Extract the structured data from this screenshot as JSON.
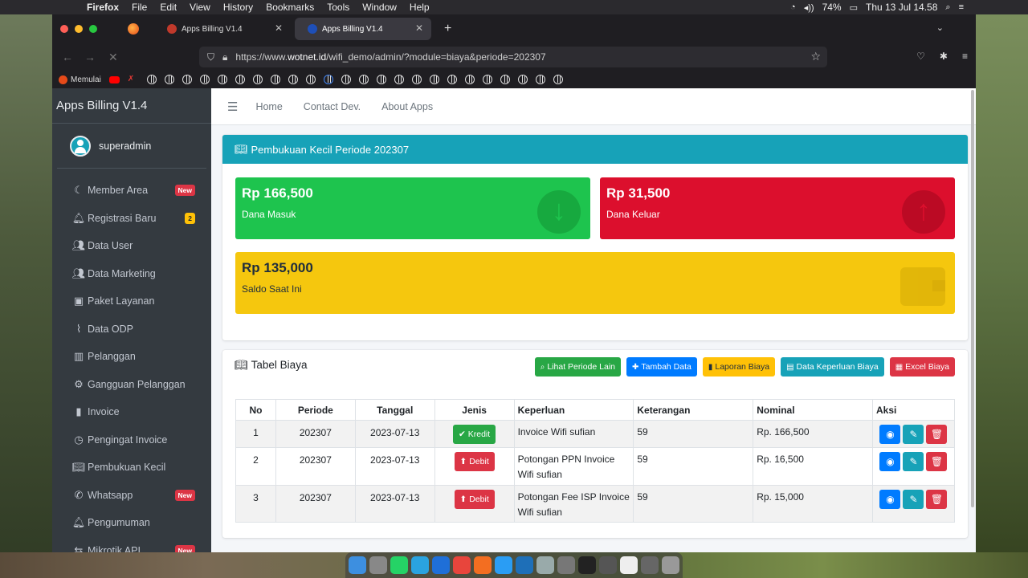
{
  "menubar": {
    "items": [
      "Firefox",
      "File",
      "Edit",
      "View",
      "History",
      "Bookmarks",
      "Tools",
      "Window",
      "Help"
    ],
    "battery": "74%",
    "clock": "Thu 13 Jul  14.58"
  },
  "browser": {
    "tabs": [
      {
        "title": "Apps Billing V1.4"
      },
      {
        "title": "Apps Billing V1.4"
      }
    ],
    "url_prefix": "https://www.",
    "url_domain": "wotnet.id",
    "url_rest": "/wifi_demo/admin/?module=biaya&periode=202307",
    "bookmark_first": "Memulai"
  },
  "app": {
    "brand": "Apps Billing V1.4",
    "username": "superadmin",
    "menu": [
      {
        "label": "Member Area",
        "icon": "moon-icon",
        "badge": "New",
        "badge_color": "red"
      },
      {
        "label": "Registrasi Baru",
        "icon": "bell-icon",
        "badge": "2",
        "badge_color": "yellow"
      },
      {
        "label": "Data User",
        "icon": "users-icon"
      },
      {
        "label": "Data Marketing",
        "icon": "user-group-icon"
      },
      {
        "label": "Paket Layanan",
        "icon": "package-icon"
      },
      {
        "label": "Data ODP",
        "icon": "antenna-icon"
      },
      {
        "label": "Pelanggan",
        "icon": "building-icon"
      },
      {
        "label": "Gangguan Pelanggan",
        "icon": "gears-icon"
      },
      {
        "label": "Invoice",
        "icon": "file-icon"
      },
      {
        "label": "Pengingat Invoice",
        "icon": "clock-icon"
      },
      {
        "label": "Pembukuan Kecil",
        "icon": "book-icon"
      },
      {
        "label": "Whatsapp",
        "icon": "whatsapp-icon",
        "badge": "New",
        "badge_color": "red"
      },
      {
        "label": "Pengumuman",
        "icon": "bell-icon"
      },
      {
        "label": "Mikrotik API",
        "icon": "router-icon",
        "badge": "New",
        "badge_color": "red"
      }
    ],
    "topnav": [
      "Home",
      "Contact Dev.",
      "About Apps"
    ]
  },
  "summary": {
    "header": "Pembukuan Kecil Periode 202307",
    "masuk_amount": "Rp 166,500",
    "masuk_label": "Dana Masuk",
    "keluar_amount": "Rp 31,500",
    "keluar_label": "Dana Keluar",
    "saldo_amount": "Rp 135,000",
    "saldo_label": "Saldo Saat Ini"
  },
  "table_card": {
    "title": "Tabel Biaya",
    "buttons": [
      {
        "label": "Lihat Periode Lain",
        "icon": "search-icon",
        "color": "#28a745"
      },
      {
        "label": "Tambah Data",
        "icon": "plus-icon",
        "color": "#007bff"
      },
      {
        "label": "Laporan Biaya",
        "icon": "file-icon",
        "color": "#ffc107"
      },
      {
        "label": "Data Keperluan Biaya",
        "icon": "list-icon",
        "color": "#17a2b8"
      },
      {
        "label": "Excel Biaya",
        "icon": "excel-icon",
        "color": "#dc3545"
      }
    ],
    "columns": [
      "No",
      "Periode",
      "Tanggal",
      "Jenis",
      "Keperluan",
      "Keterangan",
      "Nominal",
      "Aksi"
    ],
    "rows": [
      {
        "no": "1",
        "periode": "202307",
        "tanggal": "2023-07-13",
        "jenis": "Kredit",
        "keperluan": "Invoice Wifi sufian",
        "keterangan": "59",
        "nominal": "Rp. 166,500"
      },
      {
        "no": "2",
        "periode": "202307",
        "tanggal": "2023-07-13",
        "jenis": "Debit",
        "keperluan": "Potongan PPN Invoice Wifi sufian",
        "keterangan": "59",
        "nominal": "Rp. 16,500"
      },
      {
        "no": "3",
        "periode": "202307",
        "tanggal": "2023-07-13",
        "jenis": "Debit",
        "keperluan": "Potongan Fee ISP Invoice Wifi sufian",
        "keterangan": "59",
        "nominal": "Rp. 15,000"
      }
    ]
  }
}
